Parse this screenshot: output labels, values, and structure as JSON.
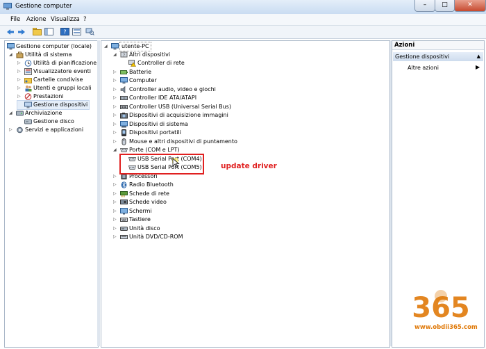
{
  "window": {
    "title": "Gestione computer",
    "close_glyph": "✕",
    "minimize_glyph": "–",
    "maximize_glyph": "□"
  },
  "menu": [
    "File",
    "Azione",
    "Visualizza",
    "?"
  ],
  "left_tree": [
    {
      "label": "Gestione computer (locale)",
      "icon": "computer-management-icon"
    },
    {
      "label": "Utilità di sistema",
      "icon": "tools-icon"
    },
    {
      "label": "Utilità di pianificazione",
      "icon": "clock-icon"
    },
    {
      "label": "Visualizzatore eventi",
      "icon": "event-viewer-icon"
    },
    {
      "label": "Cartelle condivise",
      "icon": "shared-folder-icon"
    },
    {
      "label": "Utenti e gruppi locali",
      "icon": "users-icon"
    },
    {
      "label": "Prestazioni",
      "icon": "performance-icon"
    },
    {
      "label": "Gestione dispositivi",
      "icon": "device-manager-icon"
    },
    {
      "label": "Archiviazione",
      "icon": "storage-icon"
    },
    {
      "label": "Gestione disco",
      "icon": "disk-icon"
    },
    {
      "label": "Servizi e applicazioni",
      "icon": "services-icon"
    }
  ],
  "device_tree": [
    {
      "label": "utente-PC",
      "icon": "computer-icon"
    },
    {
      "label": "Altri dispositivi",
      "icon": "unknown-device-icon"
    },
    {
      "label": "Controller di rete",
      "icon": "warning-device-icon"
    },
    {
      "label": "Batterie",
      "icon": "battery-icon"
    },
    {
      "label": "Computer",
      "icon": "computer-icon"
    },
    {
      "label": "Controller audio, video e giochi",
      "icon": "audio-icon"
    },
    {
      "label": "Controller IDE ATA/ATAPI",
      "icon": "ide-icon"
    },
    {
      "label": "Controller USB (Universal Serial Bus)",
      "icon": "usb-icon"
    },
    {
      "label": "Dispositivi di acquisizione immagini",
      "icon": "camera-icon"
    },
    {
      "label": "Dispositivi di sistema",
      "icon": "system-device-icon"
    },
    {
      "label": "Dispositivi portatili",
      "icon": "portable-device-icon"
    },
    {
      "label": "Mouse e altri dispositivi di puntamento",
      "icon": "mouse-icon"
    },
    {
      "label": "Porte (COM e LPT)",
      "icon": "port-icon"
    },
    {
      "label": "USB Serial Port (COM4)",
      "icon": "port-icon"
    },
    {
      "label": "USB Serial Port (COM5)",
      "icon": "port-icon"
    },
    {
      "label": "Processori",
      "icon": "processor-icon"
    },
    {
      "label": "Radio Bluetooth",
      "icon": "bluetooth-icon"
    },
    {
      "label": "Schede di rete",
      "icon": "network-icon"
    },
    {
      "label": "Schede video",
      "icon": "display-adapter-icon"
    },
    {
      "label": "Schermi",
      "icon": "monitor-icon"
    },
    {
      "label": "Tastiere",
      "icon": "keyboard-icon"
    },
    {
      "label": "Unità disco",
      "icon": "disk-drive-icon"
    },
    {
      "label": "Unità DVD/CD-ROM",
      "icon": "dvd-icon"
    }
  ],
  "actions": {
    "header": "Azioni",
    "section": "Gestione dispositivi",
    "item": "Altre azioni"
  },
  "annotation": {
    "text": "update driver"
  },
  "watermark": {
    "logo_text": "365",
    "url": "www.obdii365.com"
  },
  "colors": {
    "accent": "#1f5fa8",
    "annotation": "#e02020",
    "watermark": "#e07a0a"
  }
}
